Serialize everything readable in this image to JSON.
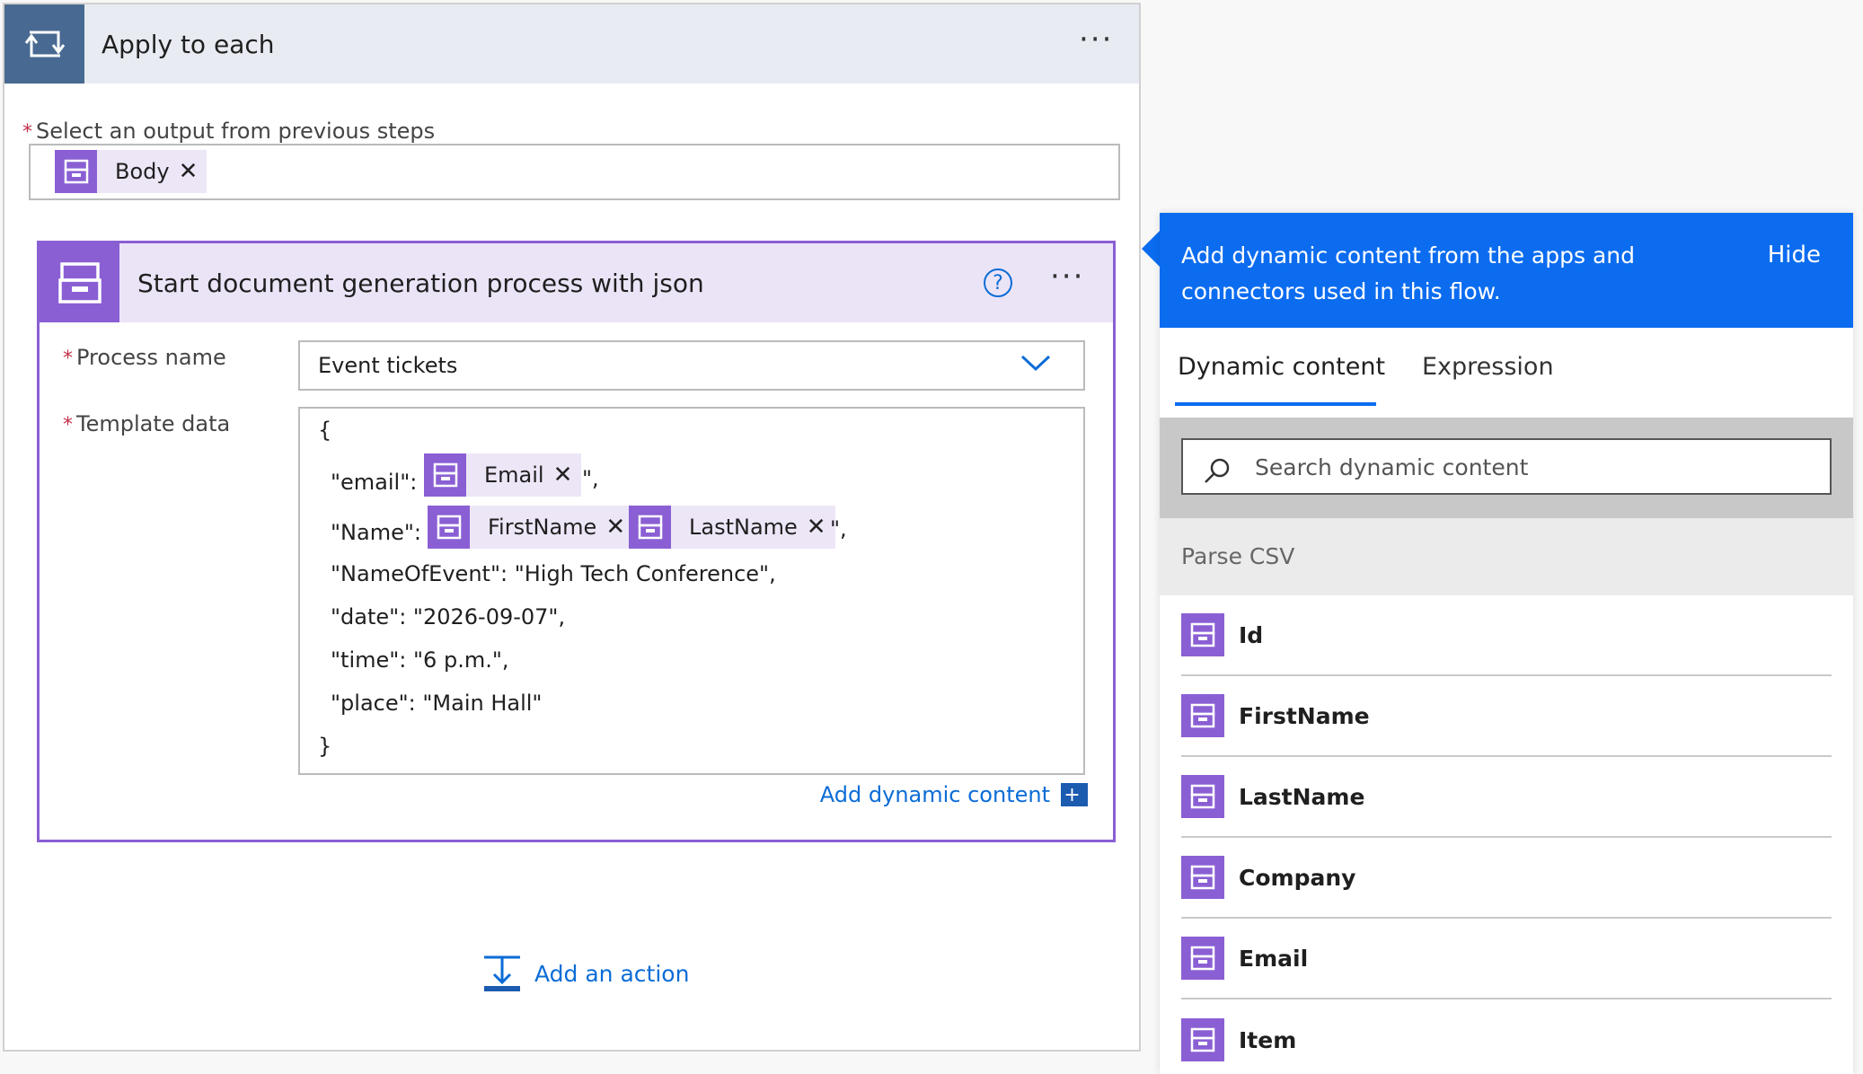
{
  "apply": {
    "title": "Apply to each",
    "menu": "···",
    "output_label": "Select an output from previous steps",
    "required": "*",
    "output_token": "Body"
  },
  "action": {
    "title": "Start document generation process with json",
    "help": "?",
    "menu": "···",
    "process_label": "Process name",
    "process_value": "Event tickets",
    "template_label": "Template data",
    "template": {
      "open": "{",
      "email_key": "\"email\": \"",
      "email_token": "Email",
      "email_end": "\",",
      "name_key": "\"Name\": \"",
      "firstname_token": "FirstName",
      "lastname_token": "LastName",
      "name_end": "\",",
      "event_line": "\"NameOfEvent\": \"High Tech Conference\",",
      "date_line": "\"date\": \"2026-09-07\",",
      "time_line": "\"time\": \"6 p.m.\",",
      "place_line": "\"place\": \"Main Hall\"",
      "close": "}"
    },
    "add_dynamic": "Add dynamic content",
    "plus": "+"
  },
  "add_action": "Add an action",
  "dynamic_panel": {
    "banner": "Add dynamic content from the apps and connectors used in this flow.",
    "hide": "Hide",
    "tabs": [
      "Dynamic content",
      "Expression"
    ],
    "search_placeholder": "Search dynamic content",
    "group": "Parse CSV",
    "items": [
      "Id",
      "FirstName",
      "LastName",
      "Company",
      "Email",
      "Item"
    ]
  },
  "colors": {
    "accent": "#0b6cf0",
    "connector_purple": "#8a5fd4",
    "loop_blue": "#486991",
    "required_red": "#c4314b"
  },
  "icons": {
    "loop": "loop-icon",
    "connector": "document-generation-icon",
    "search": "search-icon",
    "close": "close-icon",
    "chevron": "chevron-down-icon",
    "add_action": "add-action-icon"
  }
}
